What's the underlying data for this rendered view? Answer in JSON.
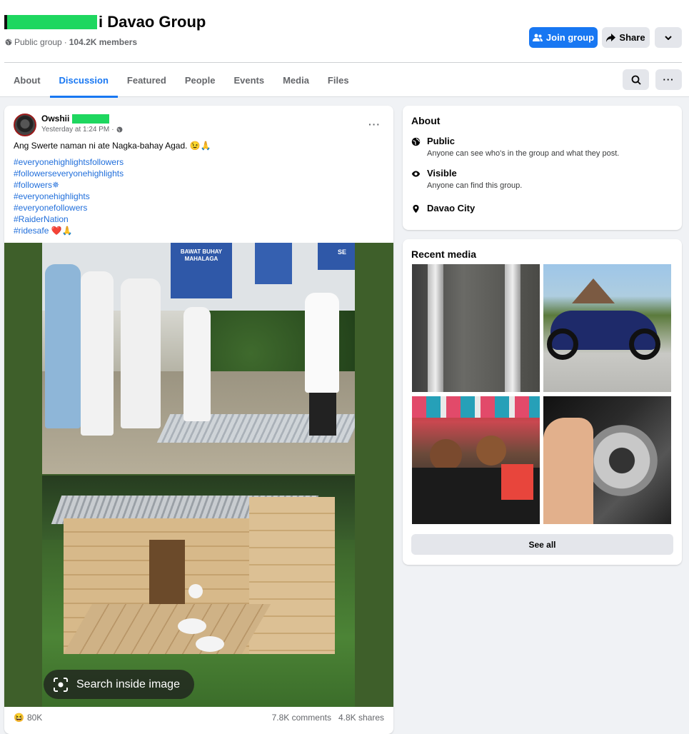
{
  "group": {
    "name": "i Davao Group",
    "privacy": "Public group",
    "separator": "·",
    "members": "104.2K members"
  },
  "actions": {
    "join": "Join group",
    "share": "Share"
  },
  "tabs": [
    "About",
    "Discussion",
    "Featured",
    "People",
    "Events",
    "Media",
    "Files"
  ],
  "active_tab": "Discussion",
  "post": {
    "author": "Owshii",
    "time": "Yesterday at 1:24 PM",
    "separator": "·",
    "text": "Ang Swerte naman ni ate Nagka-bahay Agad. 😉🙏",
    "hashtags": [
      "#everyonehighlightsfollowers",
      "#followerseveryonehighlights",
      "#followers✵",
      "#everyonehighlights",
      "#everyonefollowers",
      "#RaiderNation",
      "#ridesafe ❤️🙏"
    ],
    "image_search": "Search inside image",
    "reaction_emoji": "😆",
    "reactions": "80K",
    "comments": "7.8K comments",
    "shares": "4.8K shares",
    "sign_texts": {
      "a": "BAWAT BUHAY MAHALAGA",
      "b": "SE"
    }
  },
  "about": {
    "title": "About",
    "items": [
      {
        "icon": "globe-icon",
        "title": "Public",
        "desc": "Anyone can see who's in the group and what they post."
      },
      {
        "icon": "eye-icon",
        "title": "Visible",
        "desc": "Anyone can find this group."
      },
      {
        "icon": "location-pin-icon",
        "title": "Davao City",
        "desc": ""
      }
    ]
  },
  "recent_media": {
    "title": "Recent media",
    "see_all": "See all"
  },
  "colors": {
    "accent": "#1877f2",
    "redaction": "#1ed75f",
    "post_bg_green": "#3e5f2a"
  }
}
